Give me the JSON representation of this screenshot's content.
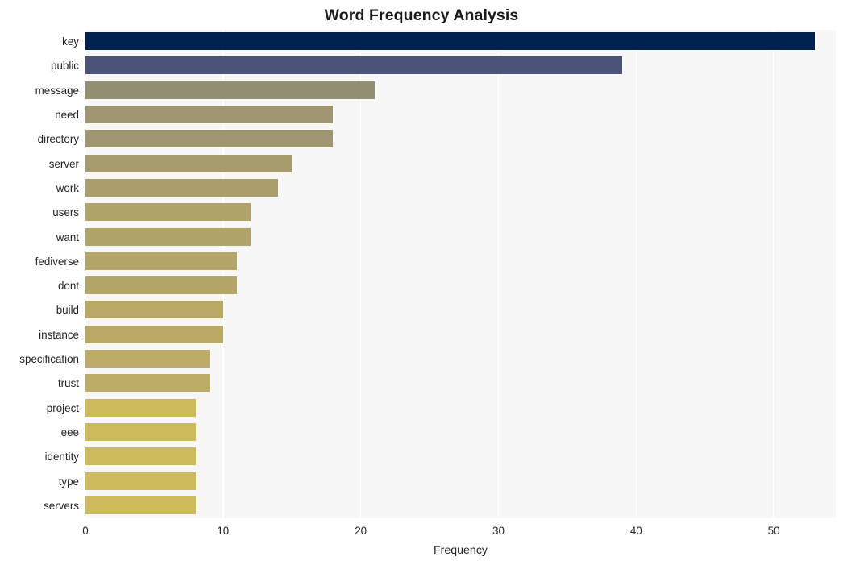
{
  "chart_data": {
    "type": "bar",
    "orientation": "horizontal",
    "title": "Word Frequency Analysis",
    "xlabel": "Frequency",
    "ylabel": "",
    "xlim": [
      0,
      54.5
    ],
    "xticks": [
      0,
      10,
      20,
      30,
      40,
      50
    ],
    "xtick_labels": [
      "0",
      "10",
      "20",
      "30",
      "40",
      "50"
    ],
    "grid": true,
    "grid_axis": "x",
    "legend": null,
    "categories": [
      "key",
      "public",
      "message",
      "need",
      "directory",
      "server",
      "work",
      "users",
      "want",
      "fediverse",
      "dont",
      "build",
      "instance",
      "specification",
      "trust",
      "project",
      "eee",
      "identity",
      "type",
      "servers"
    ],
    "values": [
      53,
      39,
      21,
      18,
      18,
      15,
      14,
      12,
      12,
      11,
      11,
      10,
      10,
      9,
      9,
      8,
      8,
      8,
      8,
      8
    ],
    "bar_colors": [
      "#00224e",
      "#4a5478",
      "#948e72",
      "#9e9670",
      "#9e9670",
      "#a79c6d",
      "#a99e6c",
      "#b0a369",
      "#b0a369",
      "#b4a668",
      "#b4a668",
      "#b8a967",
      "#b8a967",
      "#bcac66",
      "#bcac66",
      "#cbbb5b",
      "#cbbb5b",
      "#cbbb5b",
      "#cbbb5b",
      "#cbbb5b"
    ],
    "plot_background": "#f7f7f7",
    "grid_color": "#ffffff",
    "figure_background": "#ffffff"
  }
}
